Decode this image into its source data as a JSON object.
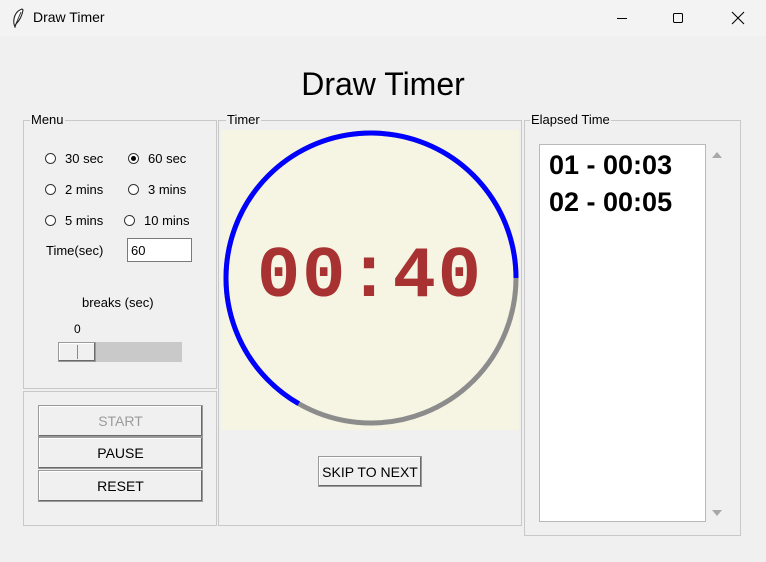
{
  "window": {
    "title": "Draw Timer",
    "icon": "feather-icon",
    "controls": [
      "minimize-icon",
      "maximize-icon",
      "close-icon"
    ]
  },
  "heading": "Draw Timer",
  "menu": {
    "label": "Menu",
    "options": [
      {
        "label": "30 sec",
        "checked": false
      },
      {
        "label": "60 sec",
        "checked": true
      },
      {
        "label": "2 mins",
        "checked": false
      },
      {
        "label": "3 mins",
        "checked": false
      },
      {
        "label": "5 mins",
        "checked": false
      },
      {
        "label": "10 mins",
        "checked": false
      }
    ],
    "time_label": "Time(sec)",
    "time_value": "60",
    "breaks_label": "breaks (sec)",
    "breaks_value": "0"
  },
  "controls": {
    "start": "START",
    "pause": "PAUSE",
    "reset": "RESET",
    "start_disabled": true
  },
  "timer": {
    "label": "Timer",
    "display": "00:40",
    "progress_fraction": 0.667,
    "colors": {
      "progress": "#0000ff",
      "remaining": "#8c8c8c",
      "text": "#a83232",
      "background": "#f6f4e2"
    },
    "skip_label": "SKIP TO NEXT"
  },
  "elapsed": {
    "label": "Elapsed Time",
    "items": [
      "01 - 00:03",
      "02 - 00:05"
    ]
  }
}
